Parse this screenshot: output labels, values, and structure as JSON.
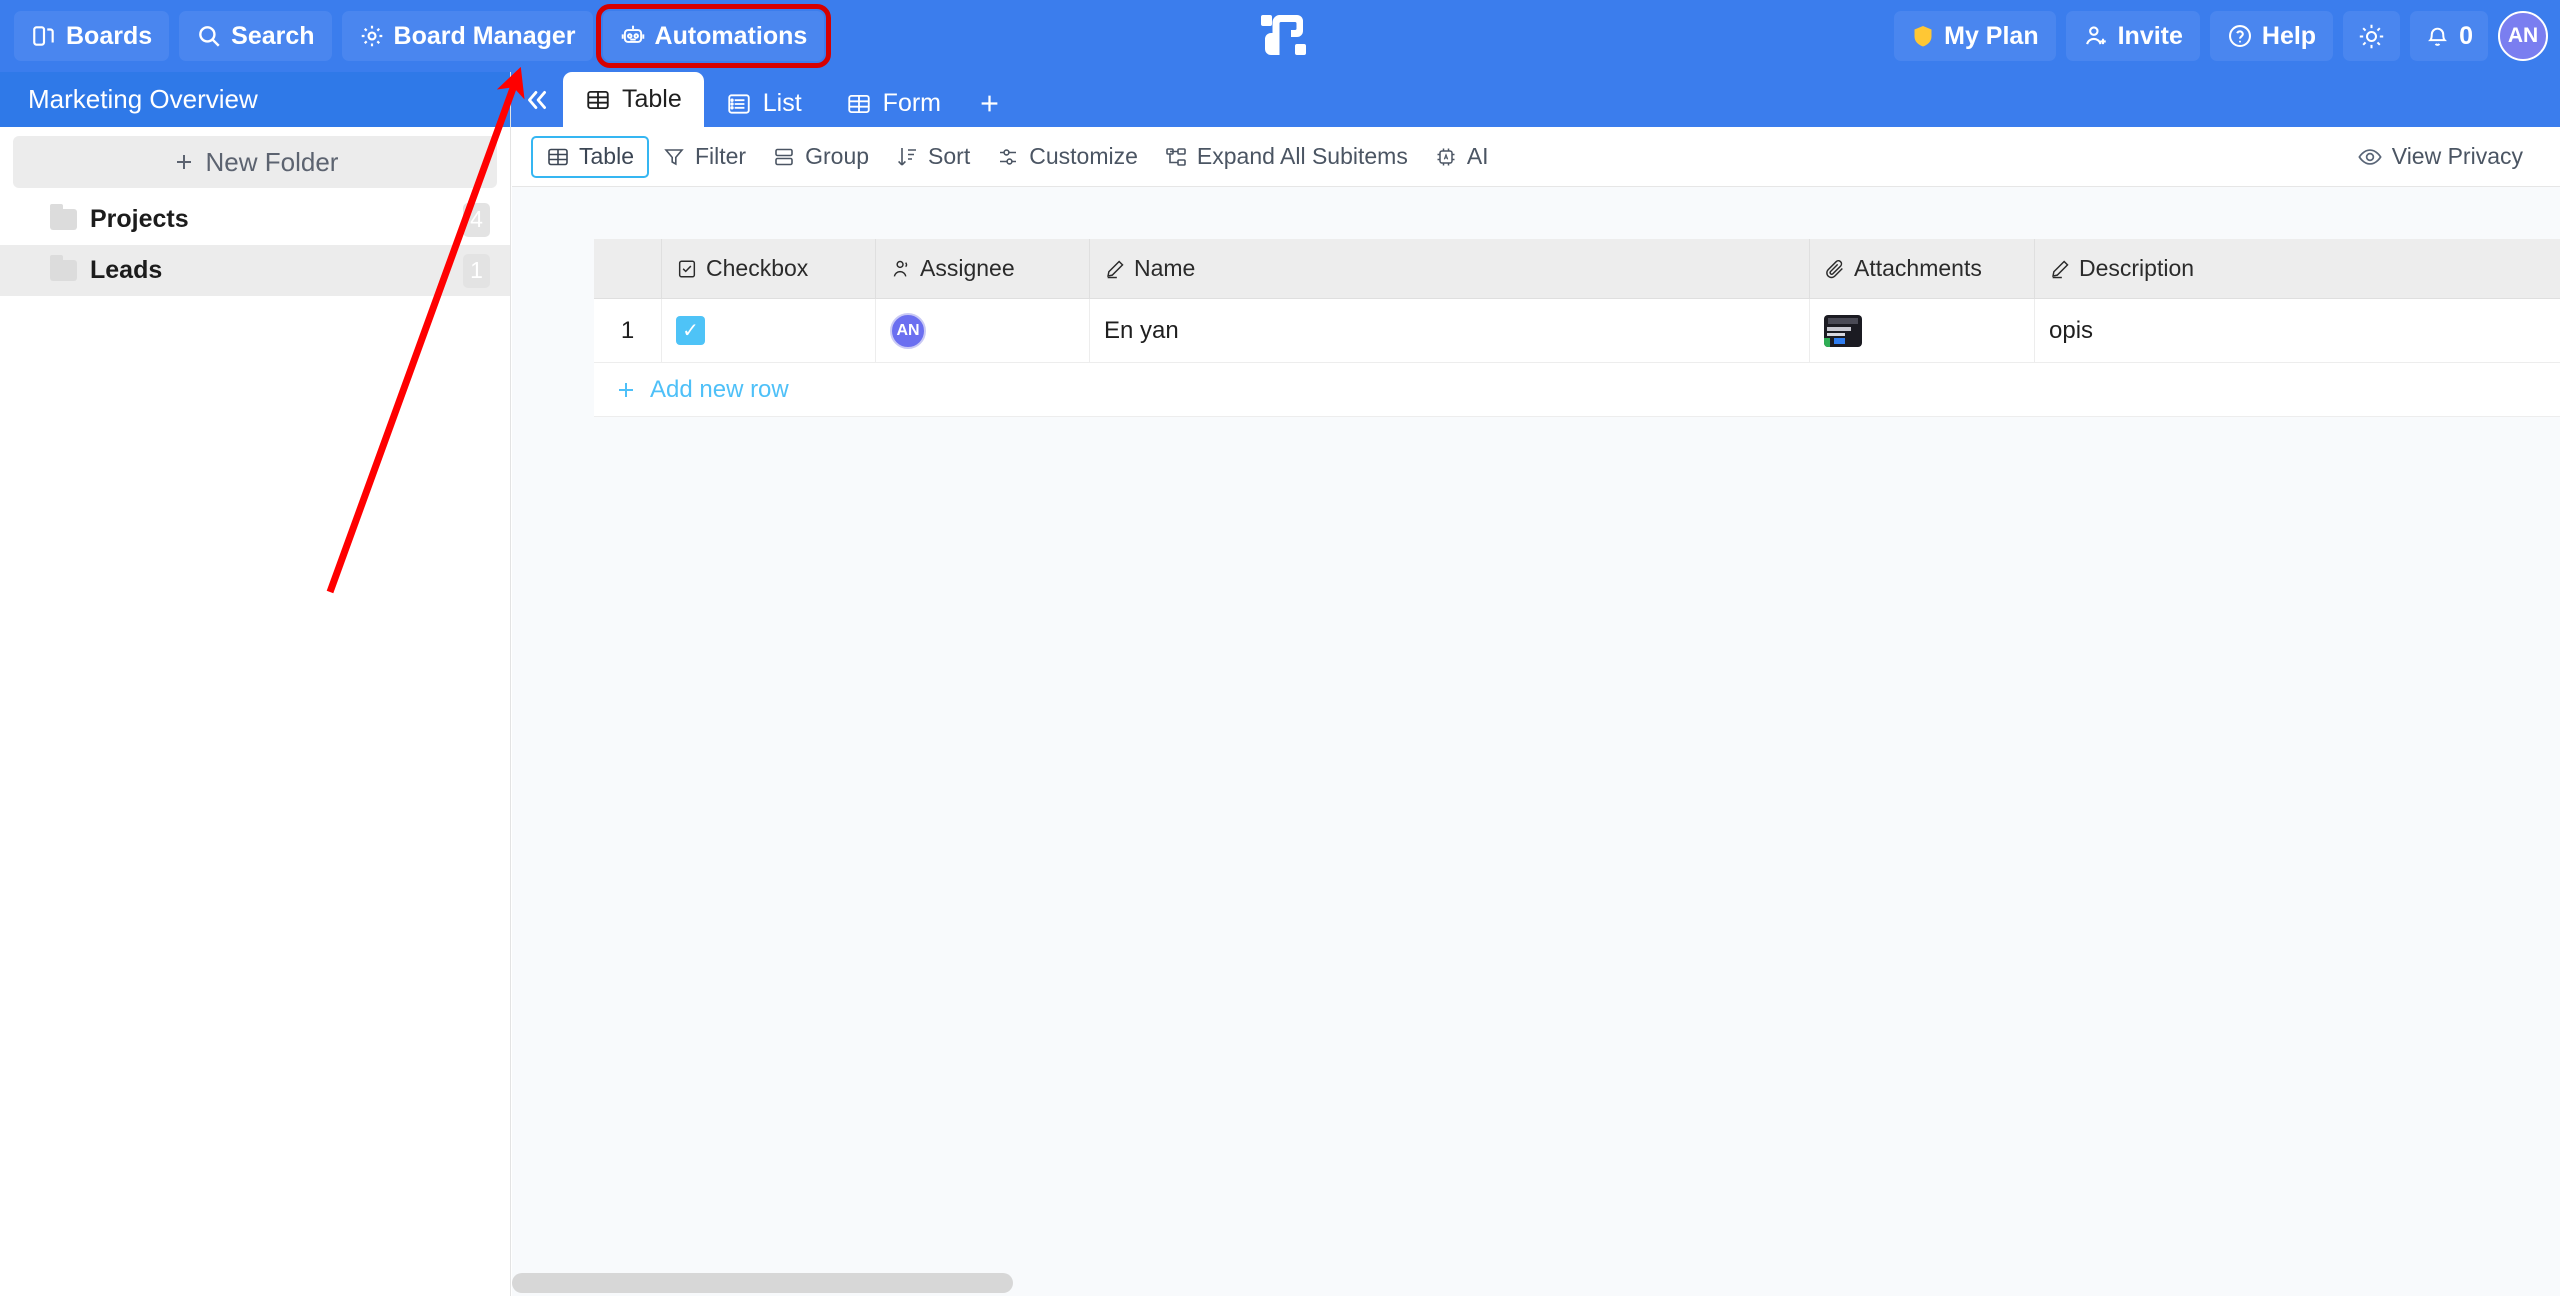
{
  "header": {
    "left_buttons": [
      {
        "label": "Boards",
        "icon": "boards-icon",
        "highlighted": false
      },
      {
        "label": "Search",
        "icon": "search-icon",
        "highlighted": false
      },
      {
        "label": "Board Manager",
        "icon": "gear-icon",
        "highlighted": false
      },
      {
        "label": "Automations",
        "icon": "robot-icon",
        "highlighted": true
      }
    ],
    "logo": "app-logo",
    "right_buttons": [
      {
        "label": "My Plan",
        "icon": "shield-icon"
      },
      {
        "label": "Invite",
        "icon": "user-plus-icon"
      },
      {
        "label": "Help",
        "icon": "question-circle-icon"
      }
    ],
    "theme_toggle_icon": "sun-icon",
    "notifications": {
      "icon": "bell-icon",
      "count": "0"
    },
    "avatar": {
      "initials": "AN"
    },
    "colors": {
      "header_bg": "#3b7ded",
      "button_bg": "#4a86ef",
      "highlight": "#d60000",
      "avatar_bg": "#7a7ef0"
    }
  },
  "sidebar": {
    "title": "Marketing Overview",
    "new_folder_label": "New Folder",
    "new_folder_icon": "plus-icon",
    "folders": [
      {
        "name": "Projects",
        "count": "4"
      },
      {
        "name": "Leads",
        "count": "1"
      }
    ]
  },
  "tabs": {
    "collapse_icon": "double-chevron-left-icon",
    "items": [
      {
        "label": "Table",
        "icon": "table-icon",
        "active": true
      },
      {
        "label": "List",
        "icon": "list-icon",
        "active": false
      },
      {
        "label": "Form",
        "icon": "form-icon",
        "active": false
      }
    ],
    "add_label": "+"
  },
  "toolbar": {
    "items": [
      {
        "label": "Table",
        "icon": "table-icon",
        "active": true
      },
      {
        "label": "Filter",
        "icon": "filter-icon",
        "active": false
      },
      {
        "label": "Group",
        "icon": "group-icon",
        "active": false
      },
      {
        "label": "Sort",
        "icon": "sort-icon",
        "active": false
      },
      {
        "label": "Customize",
        "icon": "sliders-icon",
        "active": false
      },
      {
        "label": "Expand All Subitems",
        "icon": "expand-icon",
        "active": false
      },
      {
        "label": "AI",
        "icon": "chip-icon",
        "active": false
      }
    ],
    "view_privacy": {
      "label": "View Privacy",
      "icon": "eye-icon"
    }
  },
  "table": {
    "columns": [
      {
        "label": "",
        "icon": ""
      },
      {
        "label": "Checkbox",
        "icon": "checkbox-icon"
      },
      {
        "label": "Assignee",
        "icon": "person-icon"
      },
      {
        "label": "Name",
        "icon": "pencil-icon"
      },
      {
        "label": "Attachments",
        "icon": "paperclip-icon"
      },
      {
        "label": "Description",
        "icon": "pencil-icon"
      }
    ],
    "rows": [
      {
        "number": "1",
        "checkbox": true,
        "checkbox_glyph": "✓",
        "assignee_initials": "AN",
        "name": "En yan",
        "attachment": "image-thumbnail",
        "description": "opis"
      }
    ],
    "add_new_row_label": "Add new row",
    "add_new_row_icon": "plus-icon",
    "colors": {
      "header_bg": "#ededed",
      "checkbox_checked": "#4ec3f7",
      "assignee_avatar": "#6b6ff0",
      "link": "#4ec0f8"
    }
  },
  "annotation": {
    "type": "arrow",
    "color": "#ff0000",
    "target": "Automations"
  }
}
